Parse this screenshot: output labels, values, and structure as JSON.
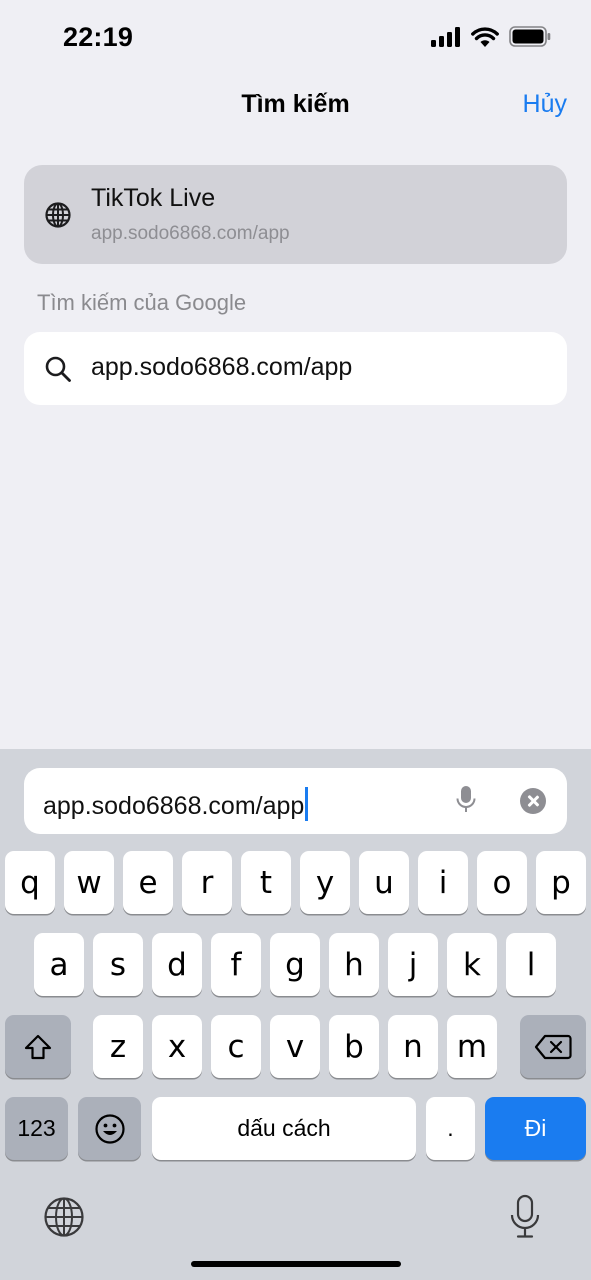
{
  "status_bar": {
    "time": "22:19"
  },
  "nav": {
    "title": "Tìm kiếm",
    "cancel_label": "Hủy"
  },
  "suggestion": {
    "title": "TikTok Live",
    "url": "app.sodo6868.com/app",
    "icon": "globe-icon"
  },
  "google_section": {
    "header": "Tìm kiếm của Google",
    "query": "app.sodo6868.com/app",
    "icon": "search-icon"
  },
  "address_bar": {
    "value": "app.sodo6868.com/app",
    "mic_icon": "microphone-icon",
    "clear_icon": "clear-icon"
  },
  "keyboard": {
    "row1": [
      "q",
      "w",
      "e",
      "r",
      "t",
      "y",
      "u",
      "i",
      "o",
      "p"
    ],
    "row2": [
      "a",
      "s",
      "d",
      "f",
      "g",
      "h",
      "j",
      "k",
      "l"
    ],
    "row3": [
      "z",
      "x",
      "c",
      "v",
      "b",
      "n",
      "m"
    ],
    "numbers_label": "123",
    "emoji_icon": "emoji-icon",
    "space_label": "dấu cách",
    "period_label": ".",
    "go_label": "Đi",
    "shift_icon": "shift-icon",
    "delete_icon": "backspace-icon",
    "globe_icon": "globe-icon",
    "dictation_icon": "microphone-icon"
  },
  "colors": {
    "accent": "#1a7cf0",
    "background": "#efeff4",
    "keyboard_bg": "#d1d4da"
  }
}
